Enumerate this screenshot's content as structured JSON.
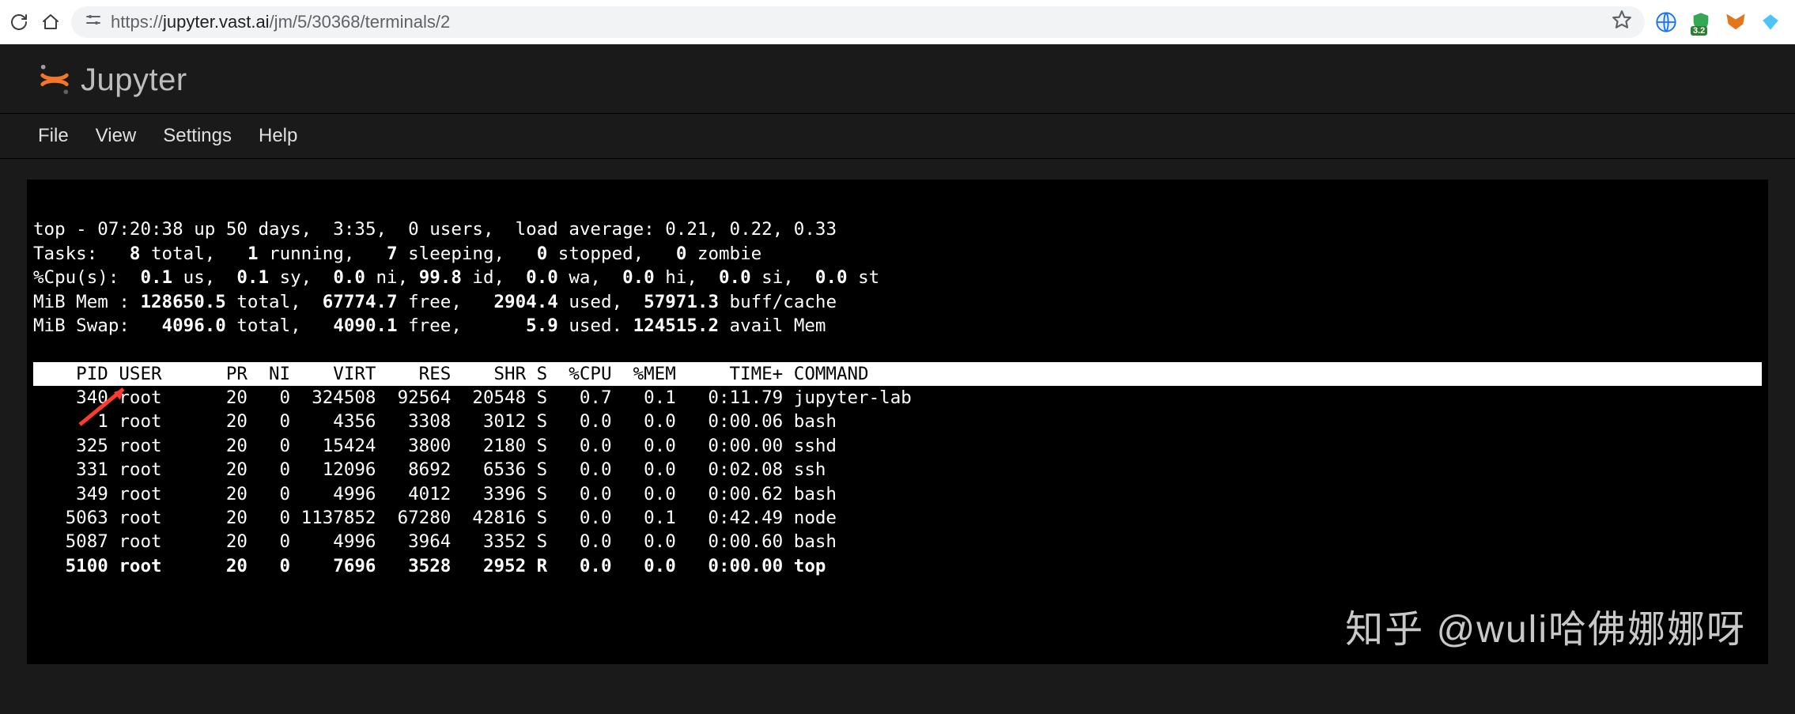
{
  "browser": {
    "url_prefix": "https://",
    "url_host": "jupyter.vast.ai",
    "url_path": "/jm/5/30368/terminals/2",
    "ext_badge": "3.2"
  },
  "jupyter": {
    "logo_text": "Jupyter",
    "menu": {
      "file": "File",
      "view": "View",
      "settings": "Settings",
      "help": "Help"
    }
  },
  "top": {
    "summary": {
      "time": "07:20:38",
      "uptime": "50 days,  3:35",
      "users": "0",
      "load": "0.21, 0.22, 0.33"
    },
    "tasks": {
      "total": "8",
      "running": "1",
      "sleeping": "7",
      "stopped": "0",
      "zombie": "0"
    },
    "cpu": {
      "us": "0.1",
      "sy": "0.1",
      "ni": "0.0",
      "id": "99.8",
      "wa": "0.0",
      "hi": "0.0",
      "si": "0.0",
      "st": "0.0"
    },
    "mem": {
      "total": "128650.5",
      "free": "67774.7",
      "used": "2904.4",
      "buffcache": "57971.3"
    },
    "swap": {
      "total": "4096.0",
      "free": "4090.1",
      "used": "5.9",
      "avail": "124515.2"
    },
    "cols": "    PID USER      PR  NI    VIRT    RES    SHR S  %CPU  %MEM     TIME+ COMMAND                                                          ",
    "procs": [
      {
        "pid": "340",
        "user": "root",
        "pr": "20",
        "ni": "0",
        "virt": "324508",
        "res": "92564",
        "shr": "20548",
        "s": "S",
        "cpu": "0.7",
        "mem": "0.1",
        "time": "0:11.79",
        "cmd": "jupyter-lab"
      },
      {
        "pid": "1",
        "user": "root",
        "pr": "20",
        "ni": "0",
        "virt": "4356",
        "res": "3308",
        "shr": "3012",
        "s": "S",
        "cpu": "0.0",
        "mem": "0.0",
        "time": "0:00.06",
        "cmd": "bash"
      },
      {
        "pid": "325",
        "user": "root",
        "pr": "20",
        "ni": "0",
        "virt": "15424",
        "res": "3800",
        "shr": "2180",
        "s": "S",
        "cpu": "0.0",
        "mem": "0.0",
        "time": "0:00.00",
        "cmd": "sshd"
      },
      {
        "pid": "331",
        "user": "root",
        "pr": "20",
        "ni": "0",
        "virt": "12096",
        "res": "8692",
        "shr": "6536",
        "s": "S",
        "cpu": "0.0",
        "mem": "0.0",
        "time": "0:02.08",
        "cmd": "ssh"
      },
      {
        "pid": "349",
        "user": "root",
        "pr": "20",
        "ni": "0",
        "virt": "4996",
        "res": "4012",
        "shr": "3396",
        "s": "S",
        "cpu": "0.0",
        "mem": "0.0",
        "time": "0:00.62",
        "cmd": "bash"
      },
      {
        "pid": "5063",
        "user": "root",
        "pr": "20",
        "ni": "0",
        "virt": "1137852",
        "res": "67280",
        "shr": "42816",
        "s": "S",
        "cpu": "0.0",
        "mem": "0.1",
        "time": "0:42.49",
        "cmd": "node"
      },
      {
        "pid": "5087",
        "user": "root",
        "pr": "20",
        "ni": "0",
        "virt": "4996",
        "res": "3964",
        "shr": "3352",
        "s": "S",
        "cpu": "0.0",
        "mem": "0.0",
        "time": "0:00.60",
        "cmd": "bash"
      },
      {
        "pid": "5100",
        "user": "root",
        "pr": "20",
        "ni": "0",
        "virt": "7696",
        "res": "3528",
        "shr": "2952",
        "s": "R",
        "cpu": "0.0",
        "mem": "0.0",
        "time": "0:00.00",
        "cmd": "top",
        "bold": true
      }
    ]
  },
  "watermark": "知乎 @wuli哈佛娜娜呀"
}
